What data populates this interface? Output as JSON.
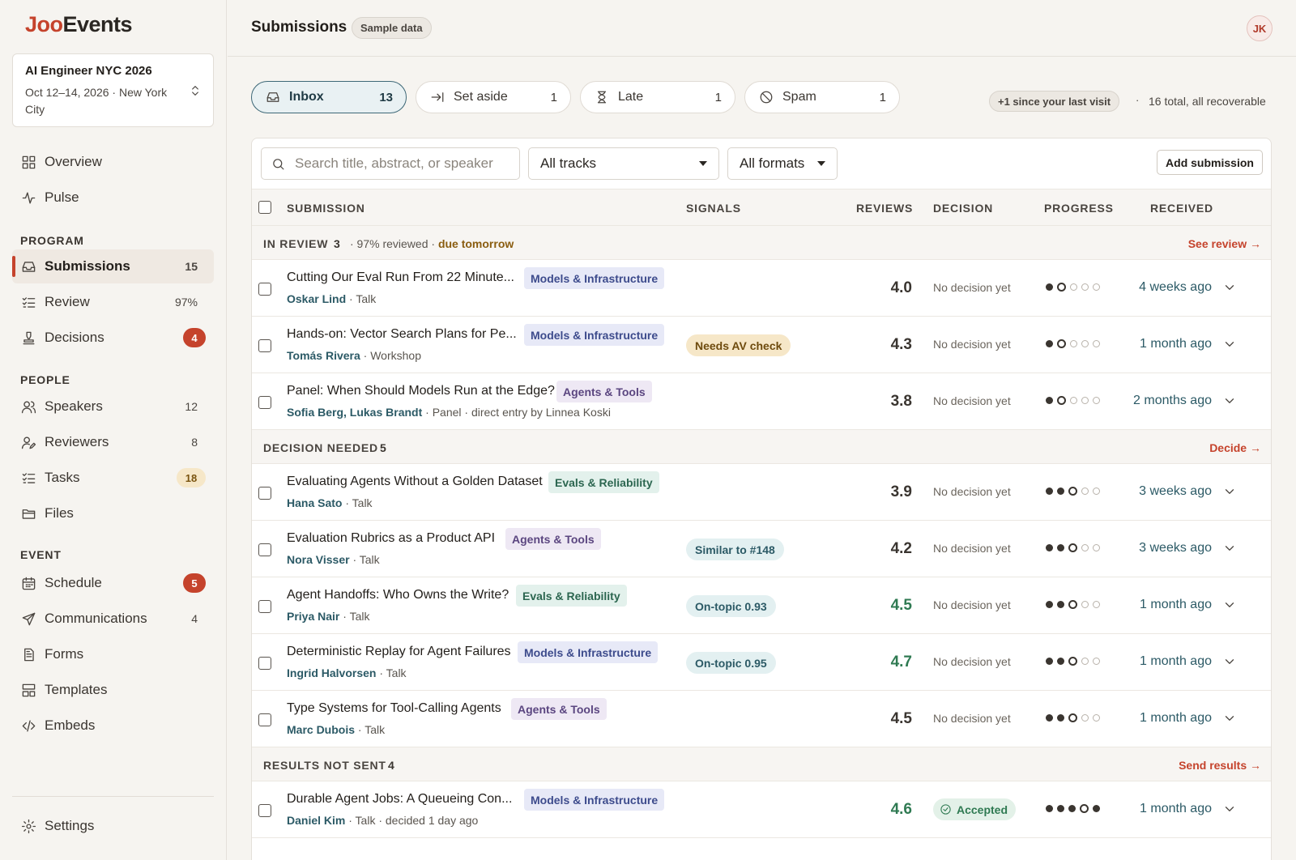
{
  "app": {
    "logo_part1": "Joo",
    "logo_part2": "Events"
  },
  "event": {
    "title": "AI Engineer NYC 2026",
    "subtitle": "Oct 12–14, 2026 · New York City"
  },
  "sidebar": {
    "overview": "Overview",
    "pulse": "Pulse",
    "program_label": "PROGRAM",
    "submissions": {
      "label": "Submissions",
      "count": "15"
    },
    "review": {
      "label": "Review",
      "count": "97%"
    },
    "decisions": {
      "label": "Decisions",
      "badge": "4"
    },
    "people_label": "PEOPLE",
    "speakers": {
      "label": "Speakers",
      "count": "12"
    },
    "reviewers": {
      "label": "Reviewers",
      "count": "8"
    },
    "tasks": {
      "label": "Tasks",
      "badge": "18"
    },
    "files": "Files",
    "event_label": "EVENT",
    "schedule": {
      "label": "Schedule",
      "badge": "5"
    },
    "communications": {
      "label": "Communications",
      "count": "4"
    },
    "forms": "Forms",
    "templates": "Templates",
    "embeds": "Embeds",
    "settings": "Settings"
  },
  "header": {
    "title": "Submissions",
    "sample": "Sample data",
    "avatar": "JK"
  },
  "filters": {
    "inbox": {
      "label": "Inbox",
      "count": "13"
    },
    "set_aside": {
      "label": "Set aside",
      "count": "1"
    },
    "late": {
      "label": "Late",
      "count": "1"
    },
    "spam": {
      "label": "Spam",
      "count": "1"
    },
    "since": "+1 since your last visit",
    "dot": "·",
    "total": "16 total, all recoverable"
  },
  "toolbar": {
    "search_placeholder": "Search title, abstract, or speaker",
    "tracks": "All tracks",
    "formats": "All formats",
    "add": "Add submission"
  },
  "columns": {
    "submission": "SUBMISSION",
    "signals": "SIGNALS",
    "reviews": "REVIEWS",
    "decision": "DECISION",
    "progress": "PROGRESS",
    "received": "RECEIVED"
  },
  "groups": [
    {
      "name": "IN REVIEW",
      "count": "3",
      "meta": "· 97% reviewed ·",
      "due": "due tomorrow",
      "action": "See review →"
    },
    {
      "name": "DECISION NEEDED",
      "count": "5",
      "action": "Decide →"
    },
    {
      "name": "RESULTS NOT SENT",
      "count": "4",
      "action": "Send results →"
    }
  ],
  "rows": [
    {
      "title": "Cutting Our Eval Run From 22 Minute...",
      "tag": "Models & Infrastructure",
      "speakers": "Oskar Lind",
      "meta": " · Talk",
      "signal": "",
      "score": "4.0",
      "decision": "No decision yet",
      "progress": 1,
      "received": "4 weeks ago"
    },
    {
      "title": "Hands-on: Vector Search Plans for Pe...",
      "tag": "Models & Infrastructure",
      "speakers": "Tomás Rivera",
      "meta": " · Workshop",
      "signal": "Needs AV check",
      "score": "4.3",
      "decision": "No decision yet",
      "progress": 1,
      "received": "1 month ago"
    },
    {
      "title": "Panel: When Should Models Run at the Edge?",
      "tag": "Agents & Tools",
      "speakers": "Sofia Berg, Lukas Brandt",
      "meta": " · Panel · direct entry by Linnea Koski",
      "signal": "",
      "score": "3.8",
      "decision": "No decision yet",
      "progress": 1,
      "received": "2 months ago"
    },
    {
      "title": "Evaluating Agents Without a Golden Dataset",
      "tag": "Evals & Reliability",
      "speakers": "Hana Sato",
      "meta": " · Talk",
      "signal": "",
      "score": "3.9",
      "decision": "No decision yet",
      "progress": 2,
      "received": "3 weeks ago"
    },
    {
      "title": "Evaluation Rubrics as a Product API",
      "tag": "Agents & Tools",
      "speakers": "Nora Visser",
      "meta": " · Talk",
      "signal": "Similar to #148",
      "score": "4.2",
      "decision": "No decision yet",
      "progress": 2,
      "received": "3 weeks ago"
    },
    {
      "title": "Agent Handoffs: Who Owns the Write?",
      "tag": "Evals & Reliability",
      "speakers": "Priya Nair",
      "meta": " · Talk",
      "signal": "On-topic 0.93",
      "score": "4.5",
      "decision": "No decision yet",
      "progress": 2,
      "received": "1 month ago"
    },
    {
      "title": "Deterministic Replay for Agent Failures",
      "tag": "Models & Infrastructure",
      "speakers": "Ingrid Halvorsen",
      "meta": " · Talk",
      "signal": "On-topic 0.95",
      "score": "4.7",
      "decision": "No decision yet",
      "progress": 2,
      "received": "1 month ago"
    },
    {
      "title": "Type Systems for Tool-Calling Agents",
      "tag": "Agents & Tools",
      "speakers": "Marc Dubois",
      "meta": " · Talk",
      "signal": "",
      "score": "4.5",
      "decision": "No decision yet",
      "progress": 2,
      "received": "1 month ago"
    },
    {
      "title": "Durable Agent Jobs: A Queueing Con...",
      "tag": "Models & Infrastructure",
      "speakers": "Daniel Kim",
      "meta": " · Talk · decided 1 day ago",
      "signal": "",
      "score": "4.6",
      "decision": "Accepted",
      "progress": 4,
      "received": "1 month ago"
    }
  ],
  "colors": {
    "accent": "#c5432c",
    "teal": "#2c5a66",
    "green": "#2f7a52"
  }
}
